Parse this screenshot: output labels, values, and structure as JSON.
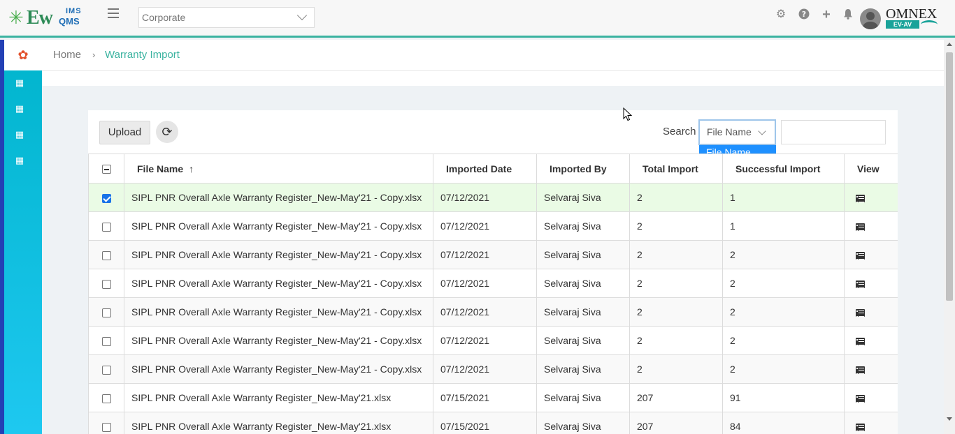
{
  "header": {
    "logo": {
      "main": "Ew",
      "sup": "IMS",
      "sub": "QMS"
    },
    "org_select": "Corporate",
    "icons": [
      "gear-icon",
      "help-icon",
      "plus-icon",
      "bell-icon"
    ],
    "brand": {
      "name": "OMNEX",
      "tag": "EV-AV"
    }
  },
  "sidebar": {
    "items": [
      "building-icon",
      "building-icon",
      "building-icon",
      "building-icon"
    ]
  },
  "breadcrumb": {
    "home": "Home",
    "separator": "›",
    "current": "Warranty Import"
  },
  "toolbar": {
    "upload_label": "Upload",
    "search_label": "Search",
    "search_field_selected": "File Name",
    "search_options": [
      "File Name"
    ],
    "search_value": ""
  },
  "table": {
    "columns": [
      "File Name",
      "Imported Date",
      "Imported By",
      "Total Import",
      "Successful Import",
      "View"
    ],
    "rows": [
      {
        "checked": true,
        "file": "SIPL PNR Overall Axle Warranty Register_New-May'21 - Copy.xlsx",
        "date": "07/12/2021",
        "by": "Selvaraj Siva",
        "total": "2",
        "success": "1"
      },
      {
        "checked": false,
        "file": "SIPL PNR Overall Axle Warranty Register_New-May'21 - Copy.xlsx",
        "date": "07/12/2021",
        "by": "Selvaraj Siva",
        "total": "2",
        "success": "1"
      },
      {
        "checked": false,
        "file": "SIPL PNR Overall Axle Warranty Register_New-May'21 - Copy.xlsx",
        "date": "07/12/2021",
        "by": "Selvaraj Siva",
        "total": "2",
        "success": "2"
      },
      {
        "checked": false,
        "file": "SIPL PNR Overall Axle Warranty Register_New-May'21 - Copy.xlsx",
        "date": "07/12/2021",
        "by": "Selvaraj Siva",
        "total": "2",
        "success": "2"
      },
      {
        "checked": false,
        "file": "SIPL PNR Overall Axle Warranty Register_New-May'21 - Copy.xlsx",
        "date": "07/12/2021",
        "by": "Selvaraj Siva",
        "total": "2",
        "success": "2"
      },
      {
        "checked": false,
        "file": "SIPL PNR Overall Axle Warranty Register_New-May'21 - Copy.xlsx",
        "date": "07/12/2021",
        "by": "Selvaraj Siva",
        "total": "2",
        "success": "2"
      },
      {
        "checked": false,
        "file": "SIPL PNR Overall Axle Warranty Register_New-May'21 - Copy.xlsx",
        "date": "07/12/2021",
        "by": "Selvaraj Siva",
        "total": "2",
        "success": "2"
      },
      {
        "checked": false,
        "file": "SIPL PNR Overall Axle Warranty Register_New-May'21.xlsx",
        "date": "07/15/2021",
        "by": "Selvaraj Siva",
        "total": "207",
        "success": "91"
      },
      {
        "checked": false,
        "file": "SIPL PNR Overall Axle Warranty Register_New-May'21.xlsx",
        "date": "07/15/2021",
        "by": "Selvaraj Siva",
        "total": "207",
        "success": "84"
      }
    ]
  },
  "colors": {
    "accent": "#3bb3a0",
    "sidebar": "#00b4cc",
    "selected_row": "#eafbe5",
    "dropdown_highlight": "#1e90ff"
  }
}
